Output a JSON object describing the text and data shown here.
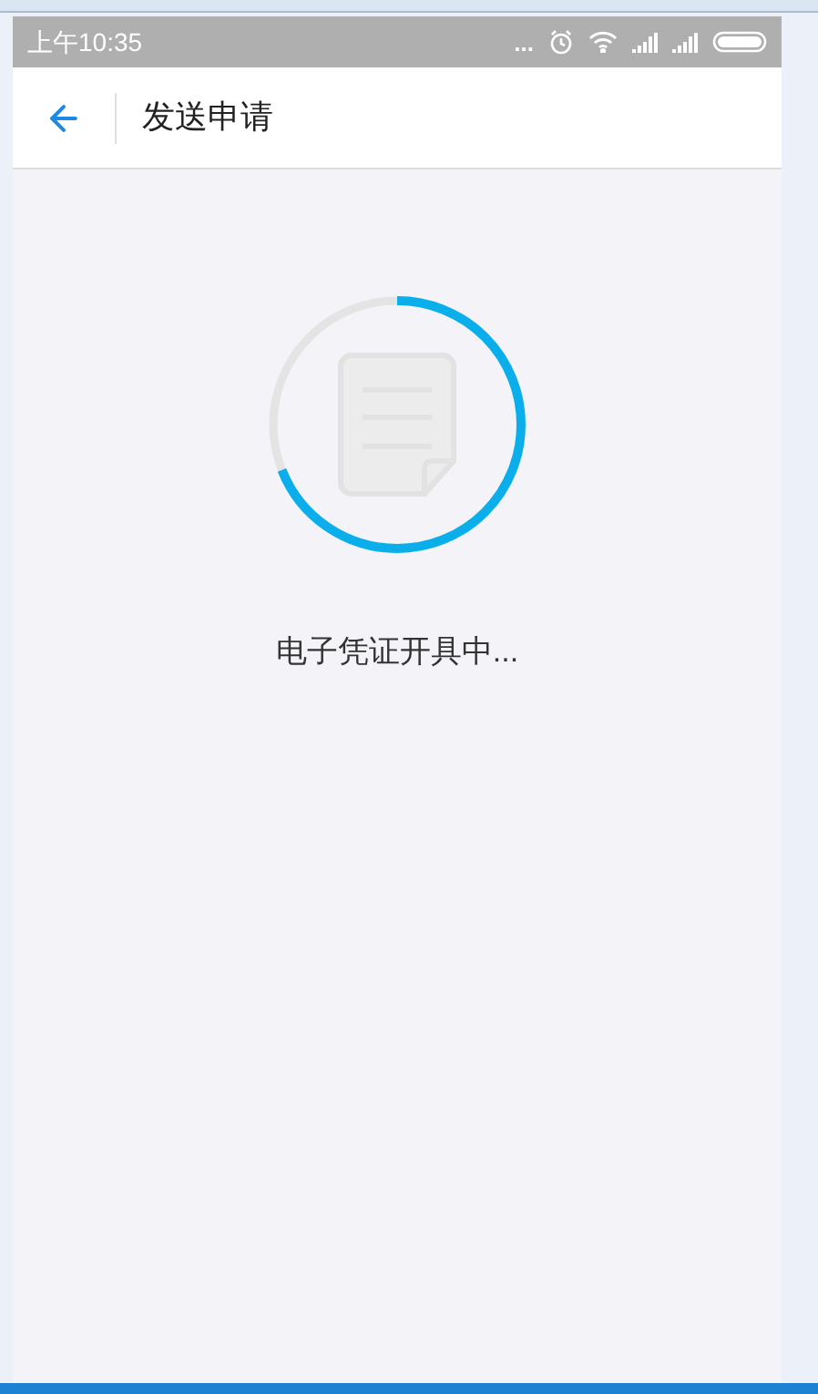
{
  "status_bar": {
    "time": "上午10:35",
    "dots": "..."
  },
  "header": {
    "title": "发送申请"
  },
  "progress": {
    "level": 0.69,
    "label": "电子凭证开具中..."
  }
}
